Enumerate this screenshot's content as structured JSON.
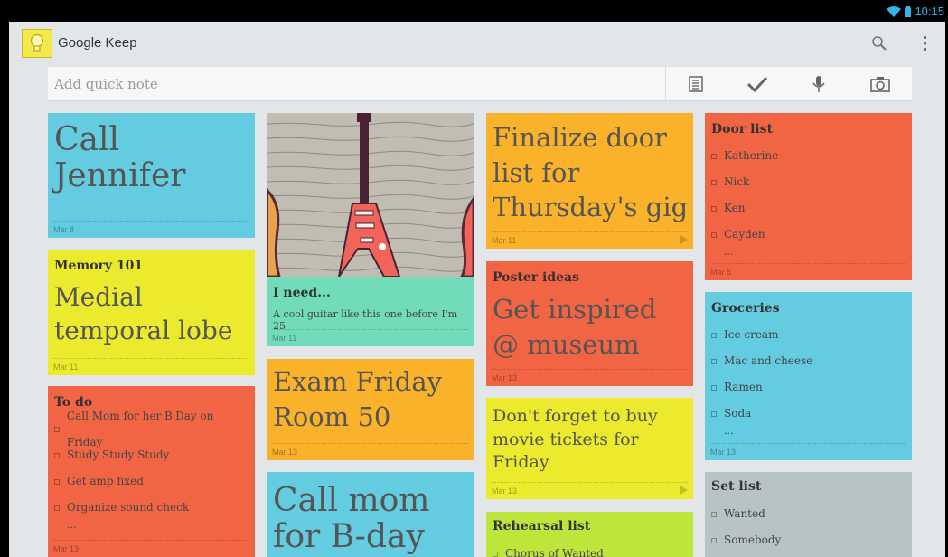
{
  "status_bar": {
    "time": "10:15"
  },
  "app": {
    "title": "Google Keep"
  },
  "quick_note": {
    "placeholder": "Add quick note"
  },
  "notes": {
    "call_jennifer": {
      "body": "Call Jennifer",
      "date": "Mar 8"
    },
    "memory": {
      "title": "Memory 101",
      "body": "Medial temporal lobe",
      "date": "Mar 11"
    },
    "todo": {
      "title": "To do",
      "items": [
        "Call Mom for her B'Day on Friday",
        "Study Study Study",
        "Get amp fixed",
        "Organize sound check"
      ],
      "more": "...",
      "date": "Mar 13"
    },
    "i_need": {
      "title": "I need...",
      "body": "A cool guitar like this one before I'm 25",
      "date": "Mar 11"
    },
    "exam": {
      "body": "Exam Friday Room 50",
      "date": "Mar 13"
    },
    "call_mom": {
      "body": "Call mom for B-day"
    },
    "finalize": {
      "body": "Finalize door list for Thursday's gig",
      "date": "Mar 11"
    },
    "poster": {
      "title": "Poster ideas",
      "body": "Get inspired @ museum",
      "date": "Mar 13"
    },
    "movie": {
      "body": "Don't forget to buy movie tickets for Friday",
      "date": "Mar 13"
    },
    "rehearsal": {
      "title": "Rehearsal list",
      "items": [
        "Chorus of Wanted"
      ]
    },
    "door_list": {
      "title": "Door list",
      "items": [
        "Katherine",
        "Nick",
        "Ken",
        "Cayden"
      ],
      "more": "...",
      "date": "Mar 8"
    },
    "groceries": {
      "title": "Groceries",
      "items": [
        "Ice cream",
        "Mac and cheese",
        "Ramen",
        "Soda"
      ],
      "more": "...",
      "date": "Mar 13"
    },
    "set_list": {
      "title": "Set list",
      "items": [
        "Wanted",
        "Somebody"
      ]
    }
  },
  "colors": {
    "blue": "#64cce0",
    "yellow": "#ecea2c",
    "red": "#f26544",
    "orange": "#f9b22a",
    "teal": "#71dbba",
    "green": "#bde53c",
    "grey": "#b7c3c5"
  }
}
